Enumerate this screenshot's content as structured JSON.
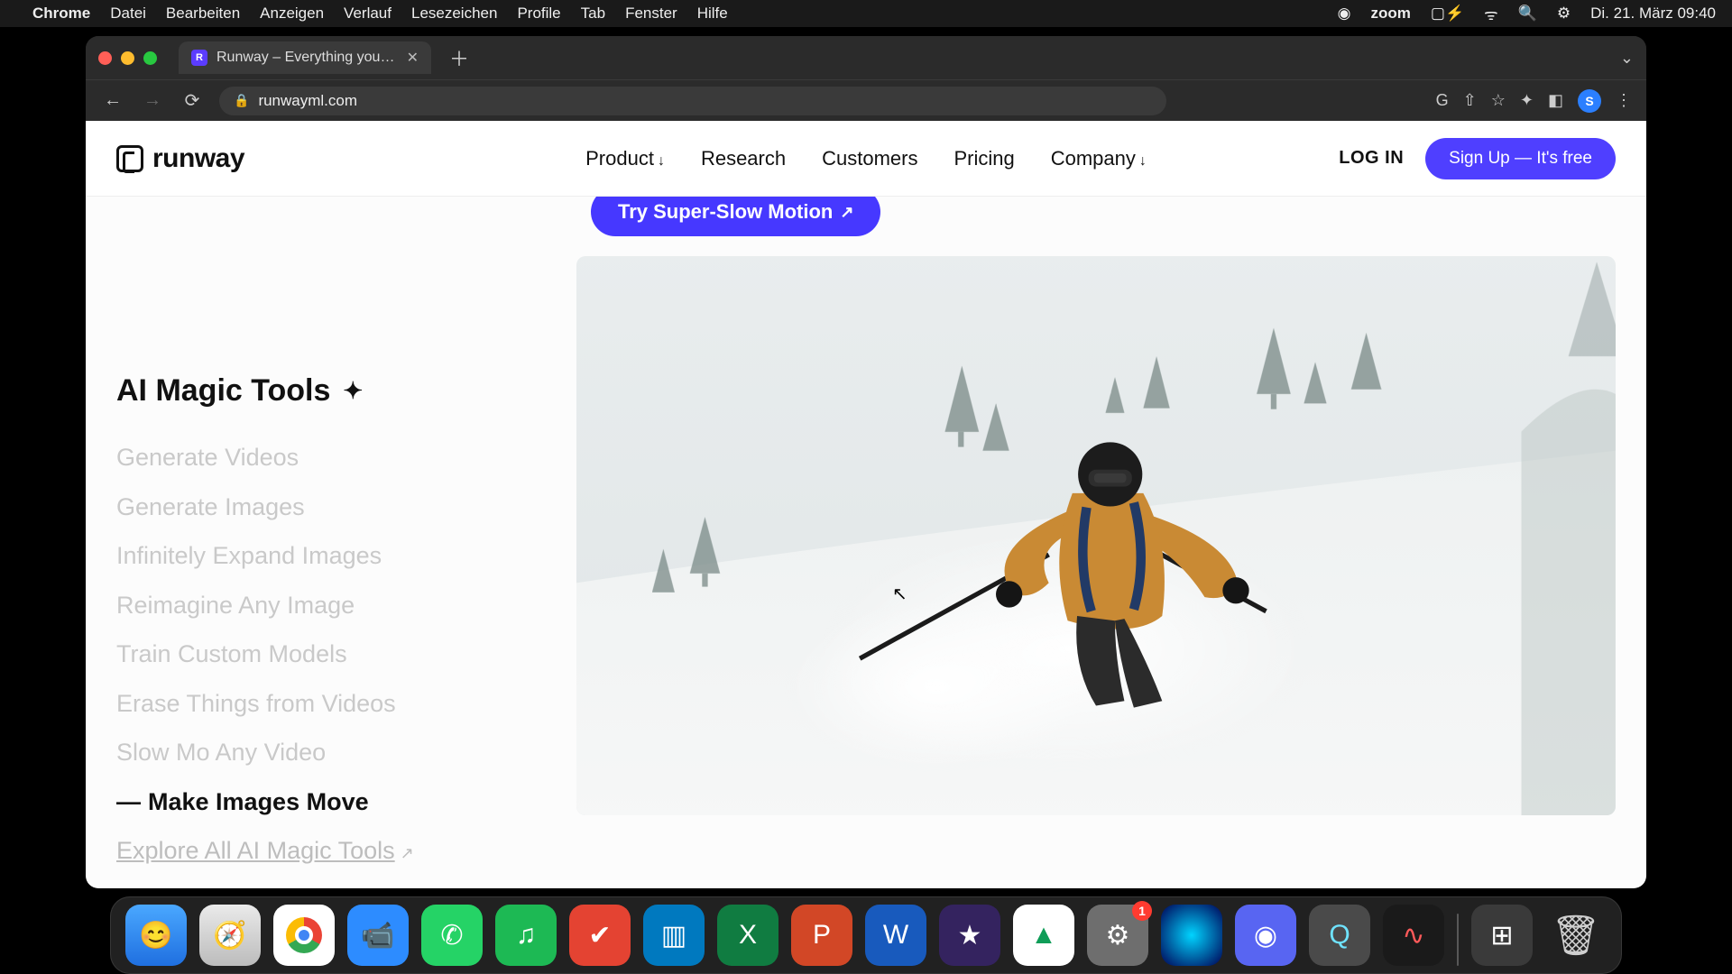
{
  "macmenu": {
    "app": "Chrome",
    "items": [
      "Datei",
      "Bearbeiten",
      "Anzeigen",
      "Verlauf",
      "Lesezeichen",
      "Profile",
      "Tab",
      "Fenster",
      "Hilfe"
    ],
    "right": {
      "zoom": "zoom",
      "clock": "Di. 21. März  09:40"
    }
  },
  "browser": {
    "tab_title": "Runway – Everything you need",
    "url": "runwayml.com",
    "profile_initial": "S"
  },
  "header": {
    "brand": "runway",
    "nav": [
      {
        "label": "Product",
        "caret": true
      },
      {
        "label": "Research",
        "caret": false
      },
      {
        "label": "Customers",
        "caret": false
      },
      {
        "label": "Pricing",
        "caret": false
      },
      {
        "label": "Company",
        "caret": true
      }
    ],
    "login": "LOG IN",
    "signup": "Sign Up — It's free"
  },
  "try_pill": "Try Super-Slow Motion",
  "sidebar": {
    "heading": "AI Magic Tools",
    "items": [
      {
        "label": "Generate Videos",
        "active": false
      },
      {
        "label": "Generate Images",
        "active": false
      },
      {
        "label": "Infinitely Expand Images",
        "active": false
      },
      {
        "label": "Reimagine Any Image",
        "active": false
      },
      {
        "label": "Train Custom Models",
        "active": false
      },
      {
        "label": "Erase Things from Videos",
        "active": false
      },
      {
        "label": "Slow Mo Any Video",
        "active": false
      },
      {
        "label": "Make Images Move",
        "active": true
      }
    ],
    "explore": "Explore All AI Magic Tools"
  },
  "dock": {
    "apps": [
      "Finder",
      "Safari",
      "Chrome",
      "Zoom",
      "WhatsApp",
      "Spotify",
      "Todoist",
      "Trello",
      "Excel",
      "PowerPoint",
      "Word",
      "iMovie",
      "Drive",
      "Settings",
      "Siri",
      "Discord",
      "QuickTime",
      "Voice Memos"
    ],
    "settings_badge": "1",
    "right": [
      "Calculator",
      "Trash"
    ]
  }
}
